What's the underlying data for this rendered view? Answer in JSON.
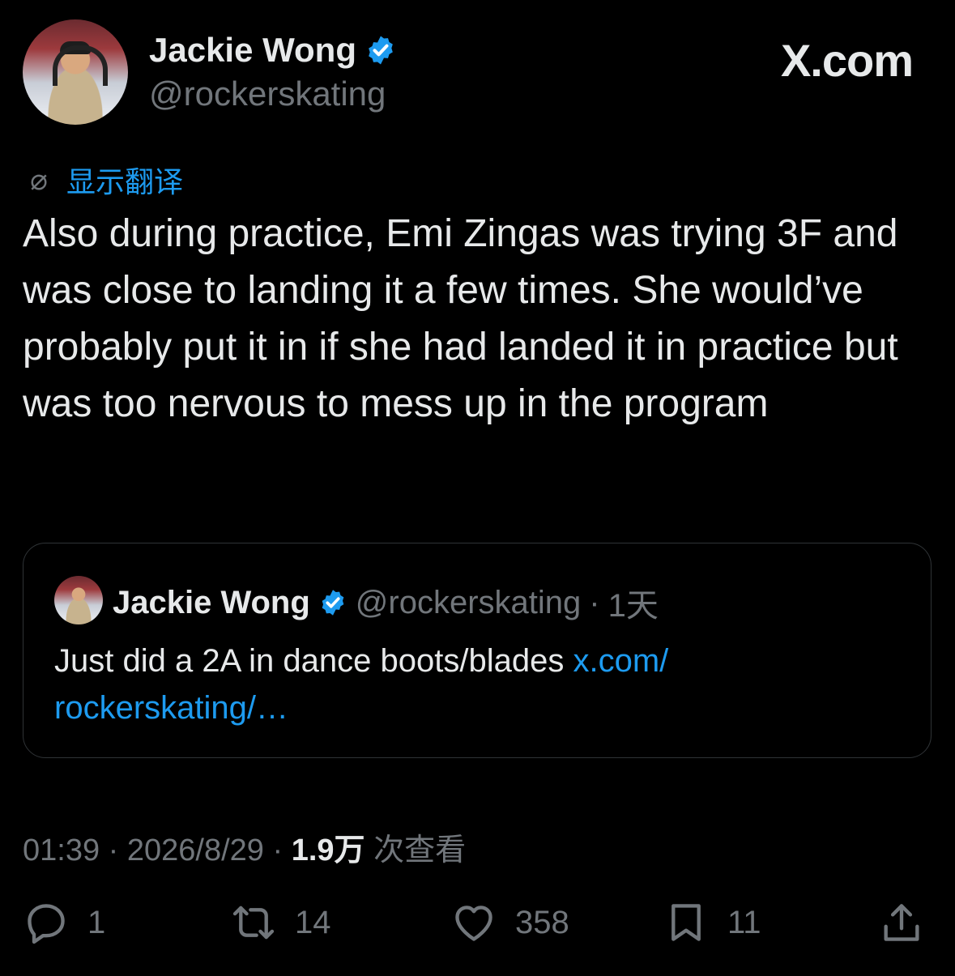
{
  "author": {
    "name": "Jackie Wong",
    "handle": "@rockerskating"
  },
  "site_label": "X.com",
  "translate_label": "显示翻译",
  "tweet_text": "Also during practice, Emi Zingas was trying 3F and was close to landing it a few times. She would’ve probably put it in if she had landed it in practice but was too nervous to mess up in the program",
  "quoted": {
    "name": "Jackie Wong",
    "handle": "@rockerskating",
    "separator": "·",
    "time": "1天",
    "text": "Just did a 2A in dance boots/blades ",
    "link": "x.com/\nrockerskating/…"
  },
  "meta": {
    "time": "01:39",
    "sep1": " · ",
    "date": "2026/8/29",
    "sep2": " · ",
    "views": "1.9万",
    "views_label": " 次查看"
  },
  "actions": {
    "replies": "1",
    "reposts": "14",
    "likes": "358",
    "bookmarks": "11"
  },
  "colors": {
    "background": "#000000",
    "text": "#e7e9ea",
    "muted": "#71767b",
    "accent": "#1d9bf0"
  },
  "icons": [
    "verified-icon",
    "translate-icon",
    "reply-icon",
    "repost-icon",
    "like-icon",
    "bookmark-icon",
    "share-icon"
  ]
}
